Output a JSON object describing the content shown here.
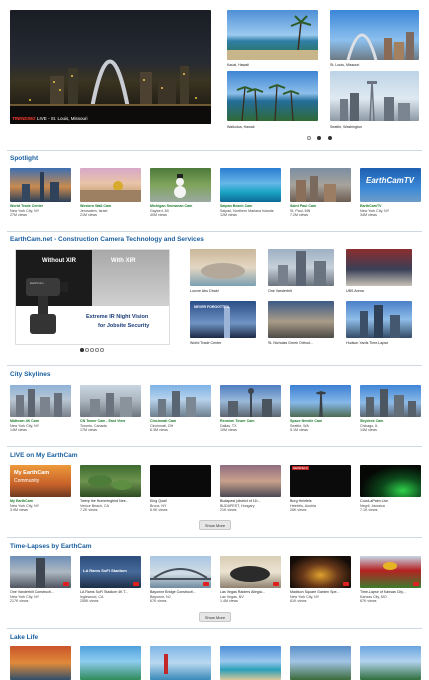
{
  "hero": {
    "badge": "TRENDING",
    "caption": "LIVE - St. Louis, Missouri"
  },
  "hero_side": [
    {
      "label": "Kauai, Hawaii"
    },
    {
      "label": "St. Louis, Missouri"
    },
    {
      "label": "Waikoloa, Hawaii"
    },
    {
      "label": "Seattle, Washington"
    }
  ],
  "spotlight": {
    "title": "Spotlight",
    "items": [
      {
        "title": "World Trade Center",
        "loc": "New York City, NY",
        "views": "27M views"
      },
      {
        "title": "Western Wall Cam",
        "loc": "Jerusalem, Israel",
        "views": "21M views"
      },
      {
        "title": "Michigan Snowman Cam",
        "loc": "Gaylord, MI",
        "views": "40M views"
      },
      {
        "title": "Saipan Beach Cam",
        "loc": "Saipan, Northern Mariana Islands",
        "views": "12M views"
      },
      {
        "title": "Saint Paul Cam",
        "loc": "St. Paul, MN",
        "views": "7.2M views"
      },
      {
        "title": "EarthCamTV",
        "loc": "New York City, NY",
        "views": "34M views",
        "overlay": "EarthCamTV"
      }
    ]
  },
  "construction": {
    "title": "EarthCam.net - Construction Camera Technology and Services",
    "promo": {
      "without": "Without XIR",
      "with": "With XIR",
      "line1": "Extreme IR Night Vision",
      "line2": "for Jobsite Security",
      "brand": "EarthCam"
    },
    "items": [
      {
        "label": "Louvre Abu Dhabi"
      },
      {
        "label": "One Vanderbilt"
      },
      {
        "label": "UBS Arena"
      },
      {
        "label": "World Trade Center",
        "overlay": "NEVER FORGOTTEN"
      },
      {
        "label": "St. Nicholas Greek Orthod..."
      },
      {
        "label": "Hudson Yards Time-Lapse"
      }
    ]
  },
  "skylines": {
    "title": "City Skylines",
    "items": [
      {
        "title": "Midtown 4K Cam",
        "loc": "New York City, NY",
        "views": "14M views"
      },
      {
        "title": "CN Tower Cam - East View",
        "loc": "Toronto, Canada",
        "views": "17M views"
      },
      {
        "title": "Cincinnati Cam",
        "loc": "Cincinnati, OH",
        "views": "6.3M views"
      },
      {
        "title": "Reunion Tower Cam",
        "loc": "Dallas, TX",
        "views": "10M views"
      },
      {
        "title": "Space Needle Cam",
        "loc": "Seattle, WA",
        "views": "5.1M views"
      },
      {
        "title": "Skydeck Cam",
        "loc": "Chicago, IL",
        "views": "14M views"
      }
    ]
  },
  "live": {
    "title": "LIVE on My EarthCam",
    "button": "Show More",
    "items": [
      {
        "title": "My EarthCam",
        "loc": "New York City, NY",
        "views": "3.9M views",
        "overlay1": "My EarthCam",
        "overlay2": "Community"
      },
      {
        "title": "Twerp the Hummingbird Nes...",
        "loc": "Venice Beach, CA",
        "views": "7.2K views"
      },
      {
        "title": "King Quail",
        "loc": "Bronx, NY",
        "views": "6.9K views"
      },
      {
        "title": "Budapest (district of 11t...",
        "loc": "BUDAPEST, Hungary",
        "views": "21K views"
      },
      {
        "title": "Burg Heinfels",
        "loc": "Heinfels, Austria",
        "views": "26K views",
        "overlay": "HEINFELS"
      },
      {
        "title": "CocoLaPalm Live",
        "loc": "Negril, Jamaica",
        "views": "7.1K views"
      }
    ]
  },
  "timelapse": {
    "title": "Time-Lapses by EarthCam",
    "button": "Show More",
    "items": [
      {
        "title": "One Vanderbilt Constructi...",
        "loc": "New York City, NY",
        "views": "217K views"
      },
      {
        "title": "LA Rams SoFi Stadium 4K T...",
        "loc": "Inglewood, CA",
        "views": "255K views",
        "overlay": "LA Rams SoFi Stadium"
      },
      {
        "title": "Bayonne Bridge Constructi...",
        "loc": "Bayonne, NJ",
        "views": "67K views"
      },
      {
        "title": "Las Vegas Raiders Allegia...",
        "loc": "Las Vegas, NV",
        "views": "1.4M views"
      },
      {
        "title": "Madison Square Garden Spe...",
        "loc": "New York City, NY",
        "views": "61K views"
      },
      {
        "title": "Time-Lapse of Kansas City...",
        "loc": "Kansas City, MO",
        "views": "67K views"
      }
    ]
  },
  "lake": {
    "title": "Lake Life"
  },
  "colors": {
    "accent": "#1a5fa0",
    "title_green": "#1b7a2b",
    "trending_red": "#e02020"
  }
}
